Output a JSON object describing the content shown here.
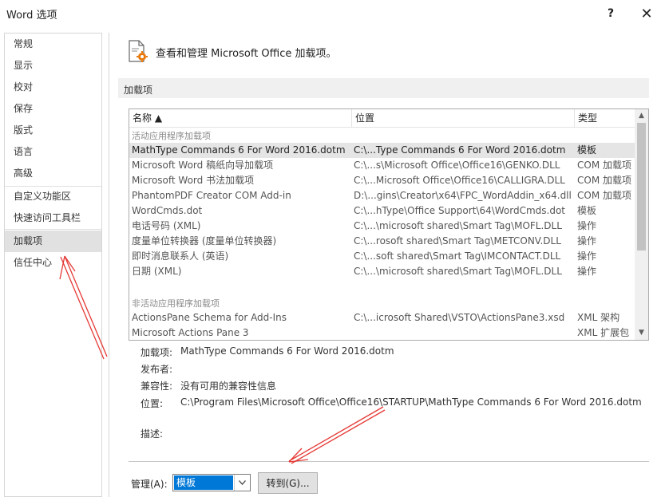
{
  "window": {
    "title": "Word 选项",
    "help_label": "?",
    "close_label": "✕"
  },
  "sidebar": {
    "items": [
      {
        "label": "常规"
      },
      {
        "label": "显示"
      },
      {
        "label": "校对"
      },
      {
        "label": "保存"
      },
      {
        "label": "版式"
      },
      {
        "label": "语言"
      },
      {
        "label": "高级"
      },
      {
        "label": "自定义功能区"
      },
      {
        "label": "快速访问工具栏"
      },
      {
        "label": "加载项"
      },
      {
        "label": "信任中心"
      }
    ],
    "active": "加载项"
  },
  "header": {
    "icon": "addin-gear-icon",
    "text": "查看和管理 Microsoft Office 加载项。"
  },
  "section": {
    "title": "加载项"
  },
  "table": {
    "columns": [
      "名称 ▲",
      "位置",
      "类型"
    ],
    "groups": [
      {
        "label": "活动应用程序加载项",
        "rows": [
          {
            "name": "MathType Commands 6 For Word 2016.dotm",
            "location": "C:\\...Type Commands 6 For Word 2016.dotm",
            "type": "模板"
          },
          {
            "name": "Microsoft Word 稿纸向导加载项",
            "location": "C:\\...s\\Microsoft Office\\Office16\\GENKO.DLL",
            "type": "COM 加载项"
          },
          {
            "name": "Microsoft Word 书法加载项",
            "location": "C:\\...Microsoft Office\\Office16\\CALLIGRA.DLL",
            "type": "COM 加载项"
          },
          {
            "name": "PhantomPDF Creator COM Add-in",
            "location": "D:\\...gins\\Creator\\x64\\FPC_WordAddin_x64.dll",
            "type": "COM 加载项"
          },
          {
            "name": "WordCmds.dot",
            "location": "C:\\...hType\\Office Support\\64\\WordCmds.dot",
            "type": "模板"
          },
          {
            "name": "电话号码 (XML)",
            "location": "C:\\...\\microsoft shared\\Smart Tag\\MOFL.DLL",
            "type": "操作"
          },
          {
            "name": "度量单位转换器 (度量单位转换器)",
            "location": "C:\\...rosoft shared\\Smart Tag\\METCONV.DLL",
            "type": "操作"
          },
          {
            "name": "即时消息联系人 (英语)",
            "location": "C:\\...soft shared\\Smart Tag\\IMCONTACT.DLL",
            "type": "操作"
          },
          {
            "name": "日期 (XML)",
            "location": "C:\\...\\microsoft shared\\Smart Tag\\MOFL.DLL",
            "type": "操作"
          }
        ]
      },
      {
        "label": "非活动应用程序加载项",
        "rows": [
          {
            "name": "ActionsPane Schema for Add-Ins",
            "location": "C:\\...icrosoft Shared\\VSTO\\ActionsPane3.xsd",
            "type": "XML 架构"
          },
          {
            "name": "Microsoft Actions Pane 3",
            "location": "",
            "type": "XML 扩展包"
          }
        ]
      }
    ]
  },
  "details": {
    "addin_label": "加载项:",
    "addin_value": "MathType Commands 6 For Word 2016.dotm",
    "publisher_label": "发布者:",
    "publisher_value": "",
    "compat_label": "兼容性:",
    "compat_value": "没有可用的兼容性信息",
    "location_label": "位置:",
    "location_value": "C:\\Program Files\\Microsoft Office\\Office16\\STARTUP\\MathType Commands 6 For Word 2016.dotm",
    "desc_label": "描述:",
    "desc_value": ""
  },
  "manage": {
    "label": "管理(A):",
    "selected": "模板",
    "go_label": "转到(G)..."
  },
  "colors": {
    "accent": "#0078d7",
    "selection": "#e5e5e5",
    "annotation": "#e53935"
  }
}
